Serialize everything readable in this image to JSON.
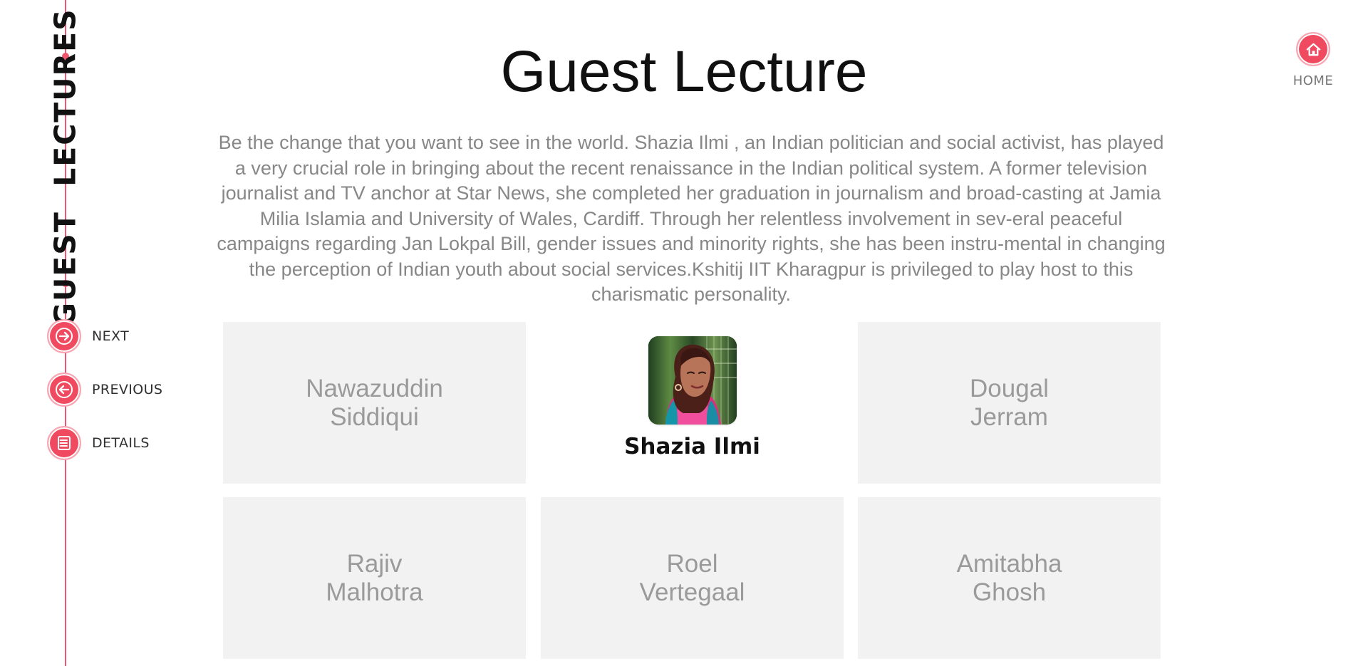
{
  "sidebar": {
    "section_title": "GUEST LECTURES",
    "nav": [
      {
        "label": "NEXT",
        "icon": "arrow-right-icon"
      },
      {
        "label": "PREVIOUS",
        "icon": "arrow-left-icon"
      },
      {
        "label": "DETAILS",
        "icon": "list-icon"
      }
    ]
  },
  "header": {
    "title": "Guest Lecture",
    "home_label": "HOME",
    "home_icon": "home-icon"
  },
  "intro": {
    "text": "Be the change that you want to see in the world. Shazia Ilmi , an Indian politician and social activist, has played a very crucial role in bringing about the recent renaissance in the Indian political system. A former television journalist and TV anchor at Star News, she completed her graduation in journalism and broad-casting at Jamia Milia Islamia and University of Wales, Cardiff. Through her relentless involvement in sev-eral peaceful campaigns regarding Jan Lokpal Bill, gender issues and minority rights, she has been instru-mental in changing the perception of Indian youth about social services.Kshitij IIT Kharagpur is privileged to play host to this charismatic personality."
  },
  "lecturers": [
    {
      "name": "Nawazuddin\nSiddiqui",
      "active": false
    },
    {
      "name": "Shazia Ilmi",
      "active": true,
      "image": "portrait-photo"
    },
    {
      "name": "Dougal\nJerram",
      "active": false
    },
    {
      "name": "Rajiv\nMalhotra",
      "active": false
    },
    {
      "name": "Roel\nVertegaal",
      "active": false
    },
    {
      "name": "Amitabha\nGhosh",
      "active": false
    }
  ],
  "colors": {
    "accent": "#f04a60",
    "inactive_card": "#f2f2f2",
    "body_text": "#878787"
  }
}
